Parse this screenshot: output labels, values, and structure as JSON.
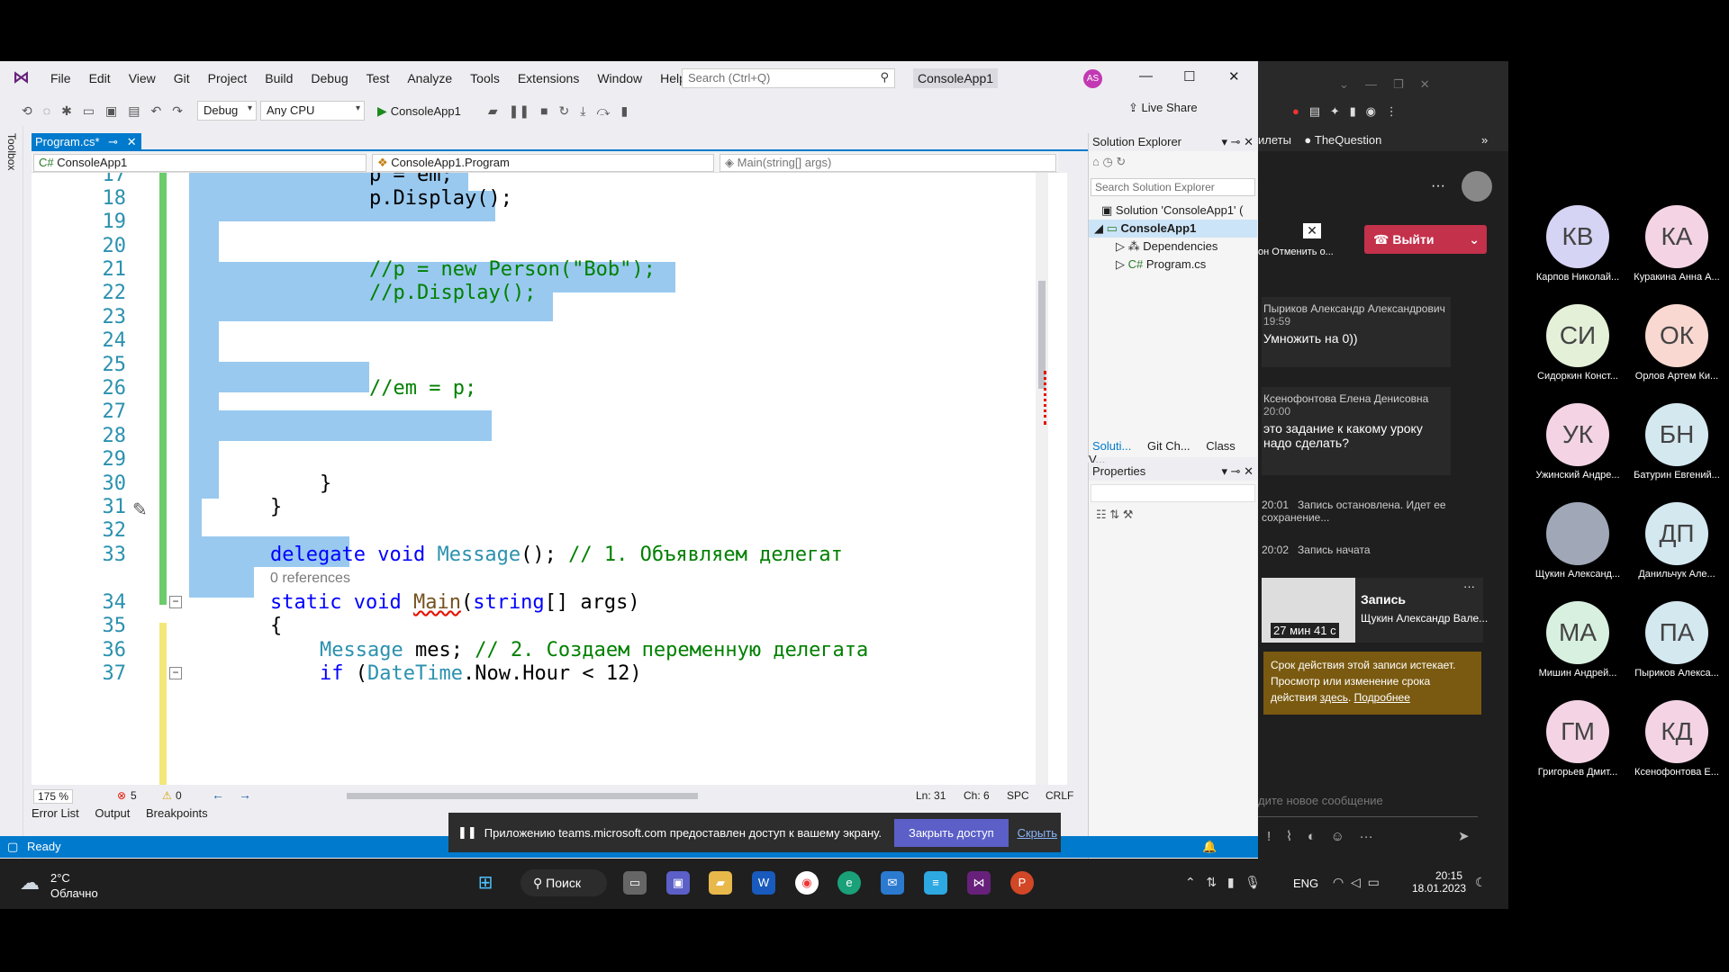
{
  "vs": {
    "menu": [
      "File",
      "Edit",
      "View",
      "Git",
      "Project",
      "Build",
      "Debug",
      "Test",
      "Analyze",
      "Tools",
      "Extensions",
      "Window",
      "Help"
    ],
    "search_placeholder": "Search (Ctrl+Q)",
    "app_title": "ConsoleApp1",
    "avatar": "AS",
    "config": "Debug",
    "platform": "Any CPU",
    "run_target": "ConsoleApp1",
    "live_share": "Live Share",
    "toolbox": "Toolbox",
    "doc_tab": "Program.cs*",
    "nav_project": "ConsoleApp1",
    "nav_class": "ConsoleApp1.Program",
    "nav_member": "Main(string[] args)",
    "zoom": "175 %",
    "errors": "5",
    "warnings": "0",
    "position": {
      "ln": "Ln: 31",
      "ch": "Ch: 6",
      "spc": "SPC",
      "crlf": "CRLF"
    },
    "bottom_tabs": [
      "Error List",
      "Output",
      "Breakpoints"
    ],
    "status": "Ready",
    "solution_explorer": {
      "title": "Solution Explorer",
      "search_placeholder": "Search Solution Explorer",
      "items": [
        "Solution 'ConsoleApp1' (",
        "ConsoleApp1",
        "Dependencies",
        "Program.cs"
      ],
      "tabs": [
        "Soluti...",
        "Git Ch...",
        "Class V..."
      ]
    },
    "properties_title": "Properties"
  },
  "code": {
    "lines": [
      {
        "n": "17",
        "text": "p = em;"
      },
      {
        "n": "18",
        "text": "p.Display();"
      },
      {
        "n": "19",
        "text": ""
      },
      {
        "n": "20",
        "text": ""
      },
      {
        "n": "21",
        "text": "//p = new Person(\"Bob\");"
      },
      {
        "n": "22",
        "text": "//p.Display();"
      },
      {
        "n": "23",
        "text": ""
      },
      {
        "n": "24",
        "text": ""
      },
      {
        "n": "25",
        "text": ""
      },
      {
        "n": "26",
        "text": "//em = p;"
      },
      {
        "n": "27",
        "text": ""
      },
      {
        "n": "28",
        "text": ""
      },
      {
        "n": "29",
        "text": ""
      },
      {
        "n": "30",
        "text": "}"
      },
      {
        "n": "31",
        "text": "}"
      },
      {
        "n": "32",
        "text": ""
      },
      {
        "n": "33",
        "kw1": "delegate",
        "kw2": "void",
        "ty": "Message",
        "rest": "();",
        "cm": "// 1. Объявляем делегат"
      },
      {
        "refs": "0 references"
      },
      {
        "n": "34",
        "kw1": "static",
        "kw2": "void",
        "fn": "Main",
        "rest": "(",
        "kw3": "string",
        "rest2": "[] args)"
      },
      {
        "n": "35",
        "text": "{"
      },
      {
        "n": "36",
        "ty": "Message",
        "rest": " mes;",
        "cm": "// 2. Создаем переменную делегата"
      },
      {
        "n": "37",
        "kw1": "if",
        "rest": " (",
        "ty": "DateTime",
        "rest2": ".Now.Hour < 12)"
      }
    ]
  },
  "share_bar": {
    "text": "Приложению teams.microsoft.com предоставлен доступ к вашему экрану.",
    "stop": "Закрыть доступ",
    "hide": "Скрыть"
  },
  "taskbar": {
    "temp": "2°C",
    "weather": "Облачно",
    "search": "Поиск",
    "lang": "ENG",
    "time": "20:15",
    "date": "18.01.2023"
  },
  "teams": {
    "bookmarks": [
      "илеты",
      "TheQuestion"
    ],
    "cancel": "Отменить о...",
    "leave": "Выйти",
    "messages": [
      {
        "name": "Пыриков Александр Александрович",
        "time": "19:59",
        "text": "Умножить на 0))"
      },
      {
        "name": "Ксенофонтова Елена Денисовна",
        "time": "20:00",
        "text": "это задание к какому уроку надо сделать?"
      }
    ],
    "events": [
      {
        "time": "20:01",
        "text": "Запись остановлена. Идет ее сохранение..."
      },
      {
        "time": "20:02",
        "text": "Запись начата"
      }
    ],
    "recording": {
      "title": "Запись",
      "author": "Щукин Александр Вале...",
      "duration": "27 мин 41 с"
    },
    "notice": "Срок действия этой записи истекает. Просмотр или изменение срока действия",
    "notice_here": "здесь",
    "notice_more": "Подробнее",
    "compose": "дите новое сообщение"
  },
  "participants": [
    {
      "initials": "КВ",
      "name": "Карпов Николай...",
      "color": "#d6d4f4"
    },
    {
      "initials": "КА",
      "name": "Куракина Анна А...",
      "color": "#f4d4e4"
    },
    {
      "initials": "СИ",
      "name": "Сидоркин Конст...",
      "color": "#e4f0d8"
    },
    {
      "initials": "ОК",
      "name": "Орлов Артем Ки...",
      "color": "#f8d8d0"
    },
    {
      "initials": "УК",
      "name": "Ужинский Андре...",
      "color": "#f4d4e4"
    },
    {
      "initials": "БН",
      "name": "Батурин Евгений...",
      "color": "#d4e8f0"
    },
    {
      "initials": "",
      "name": "Щукин Александ...",
      "color": "#a0a8b8"
    },
    {
      "initials": "ДП",
      "name": "Данильчук Але...",
      "color": "#d4e8f0"
    },
    {
      "initials": "МА",
      "name": "Мишин Андрей...",
      "color": "#d8f0e0"
    },
    {
      "initials": "ПА",
      "name": "Пыриков Алекса...",
      "color": "#d4e8f0"
    },
    {
      "initials": "ГМ",
      "name": "Григорьев Дмит...",
      "color": "#f4d4e4"
    },
    {
      "initials": "КД",
      "name": "Ксенофонтова Е...",
      "color": "#f4d4e4"
    }
  ]
}
